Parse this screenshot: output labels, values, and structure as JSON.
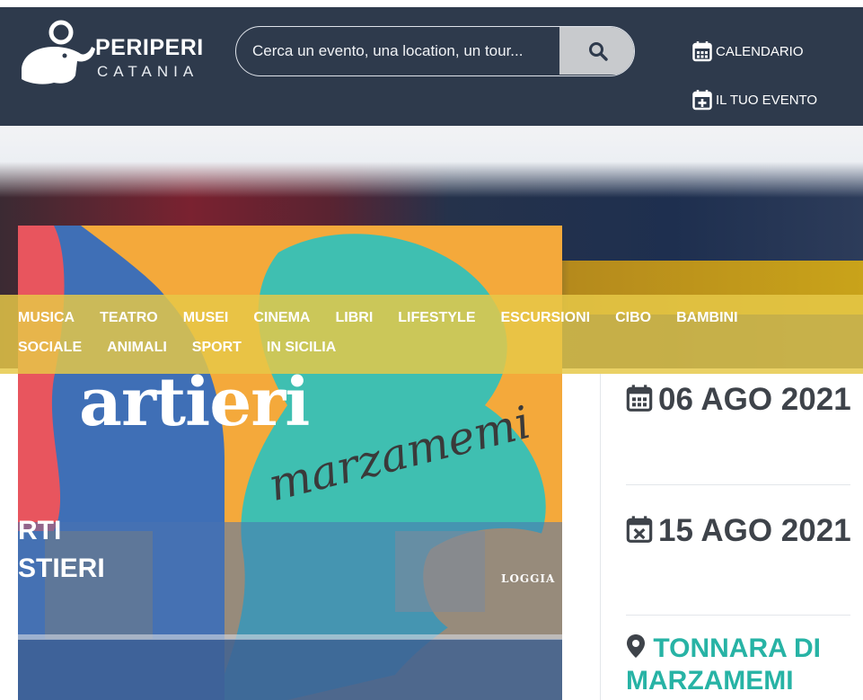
{
  "brand": {
    "title": "PERIPERI",
    "subtitle": "CATANIA"
  },
  "search": {
    "placeholder": "Cerca un evento, una location, un tour...",
    "value": "",
    "button_icon": "search-icon"
  },
  "nav": {
    "calendar": "CALENDARIO",
    "your_event": "IL TUO EVENTO"
  },
  "categories": {
    "row1": [
      "MUSICA",
      "TEATRO",
      "MUSEI",
      "CINEMA",
      "LIBRI",
      "LIFESTYLE",
      "ESCURSIONI",
      "CIBO",
      "BAMBINI"
    ],
    "row2": [
      "SOCIALE",
      "ANIMALI",
      "SPORT",
      "IN SICILIA"
    ]
  },
  "poster": {
    "headline": "artieri",
    "script": "marzamemi",
    "left_text_1": "RTI",
    "left_text_2": "STIERI",
    "loggia": "LOGGIA"
  },
  "event": {
    "start_date": "06 AGO 2021",
    "end_date": "15 AGO 2021",
    "location": "TONNARA DI MARZAMEMI"
  },
  "colors": {
    "header_bg": "#2e3a4c",
    "category_bar": "#e6c848",
    "accent_teal": "#27b3a5",
    "text_dark": "#3e434a"
  }
}
